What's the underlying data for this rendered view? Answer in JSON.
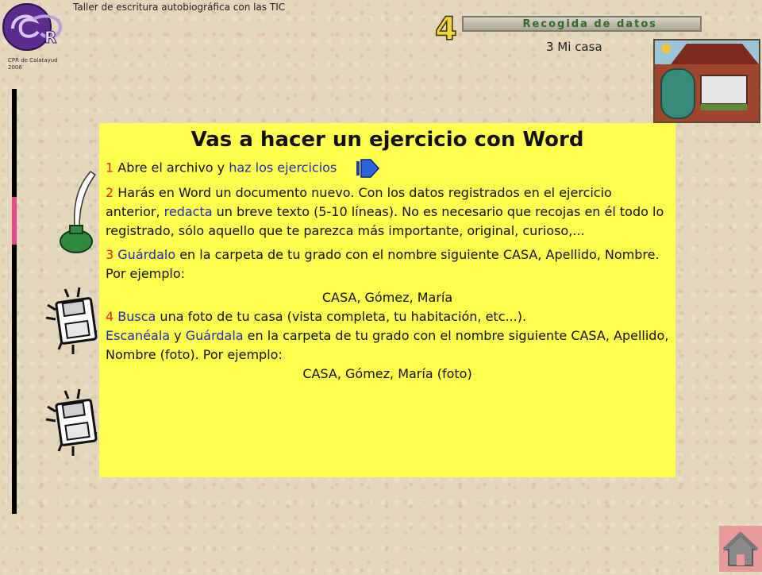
{
  "header": {
    "course_title": "Taller de escritura autobiográfica con las TIC",
    "logo_caption": "CPR de Calatayud\n2006",
    "chapter_number": "4",
    "banner_label": "Recogida de datos",
    "section_title": "3 Mi casa"
  },
  "panel": {
    "title": "Vas a hacer un ejercicio con Word",
    "step1": {
      "num": "1",
      "text_a": " Abre el archivo y ",
      "link": "haz los ejercicios"
    },
    "step2": {
      "num": "2",
      "text_a": " Harás en Word un documento nuevo.  Con los datos registrados en el ejercicio anterior, ",
      "link": "redacta",
      "text_b": " un breve texto (5-10 líneas). No es necesario que recojas en él todo lo registrado, sólo aquello que te parezca más importante, original, curioso,..."
    },
    "step3": {
      "num": "3",
      "link": "Guárdalo",
      "text_a": "  en la carpeta de tu grado con el nombre siguiente CASA, Apellido, Nombre. Por ejemplo:",
      "example": "CASA, Gómez, María"
    },
    "step4": {
      "num": "4",
      "link_a": "Busca",
      "text_a": " una foto de tu casa (vista completa, tu habitación, etc...).",
      "link_b": "Escanéala",
      "text_b": " y ",
      "link_c": "Guárdala",
      "text_c": "  en la carpeta de tu grado con el nombre siguiente CASA, Apellido, Nombre (foto). Por ejemplo:",
      "example": "CASA, Gómez, María (foto)"
    }
  },
  "icons": {
    "logo": "cpr-logo-icon",
    "quill": "quill-inkwell-icon",
    "floppy": "floppy-disk-icon",
    "next": "next-arrow-icon",
    "home": "home-icon",
    "house": "house-photo"
  },
  "colors": {
    "panel_bg": "#ffff4d",
    "step_number": "#e6232a",
    "link": "#1c2fb7",
    "home_button": "#e89a9a"
  }
}
